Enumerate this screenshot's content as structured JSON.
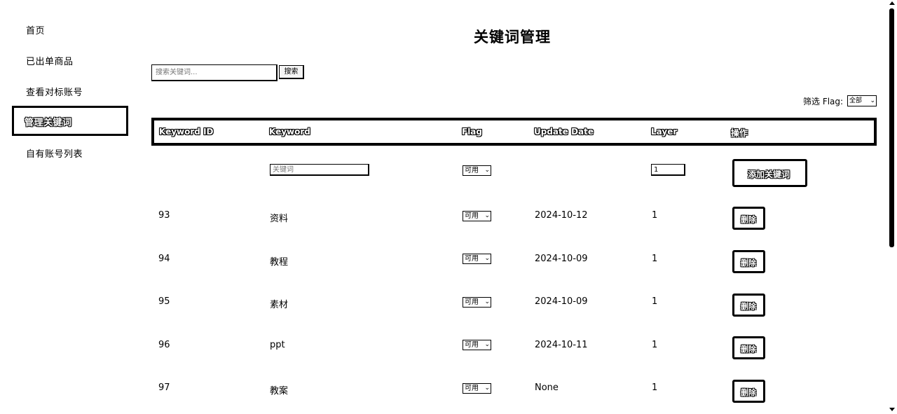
{
  "sidebar": {
    "items": [
      {
        "label": "首页"
      },
      {
        "label": "已出单商品"
      },
      {
        "label": "查看对标账号"
      },
      {
        "label": "管理关键词",
        "active": true
      },
      {
        "label": "自有账号列表"
      }
    ]
  },
  "page": {
    "title": "关键词管理"
  },
  "search": {
    "placeholder": "搜索关键词...",
    "button_label": "搜索"
  },
  "filter": {
    "label": "筛选 Flag:",
    "selected": "全部"
  },
  "table": {
    "headers": [
      "Keyword ID",
      "Keyword",
      "Flag",
      "Update Date",
      "Layer",
      "操作"
    ],
    "add_row": {
      "keyword_placeholder": "关键词",
      "flag": "可用",
      "layer_value": "1",
      "button_label": "添加关键词"
    },
    "rows": [
      {
        "id": "93",
        "keyword": "资料",
        "flag": "可用",
        "date": "2024-10-12",
        "layer": "1",
        "action": "删除"
      },
      {
        "id": "94",
        "keyword": "教程",
        "flag": "可用",
        "date": "2024-10-09",
        "layer": "1",
        "action": "删除"
      },
      {
        "id": "95",
        "keyword": "素材",
        "flag": "可用",
        "date": "2024-10-09",
        "layer": "1",
        "action": "删除"
      },
      {
        "id": "96",
        "keyword": "ppt",
        "flag": "可用",
        "date": "2024-10-11",
        "layer": "1",
        "action": "删除"
      },
      {
        "id": "97",
        "keyword": "教案",
        "flag": "可用",
        "date": "None",
        "layer": "1",
        "action": "删除"
      }
    ]
  }
}
